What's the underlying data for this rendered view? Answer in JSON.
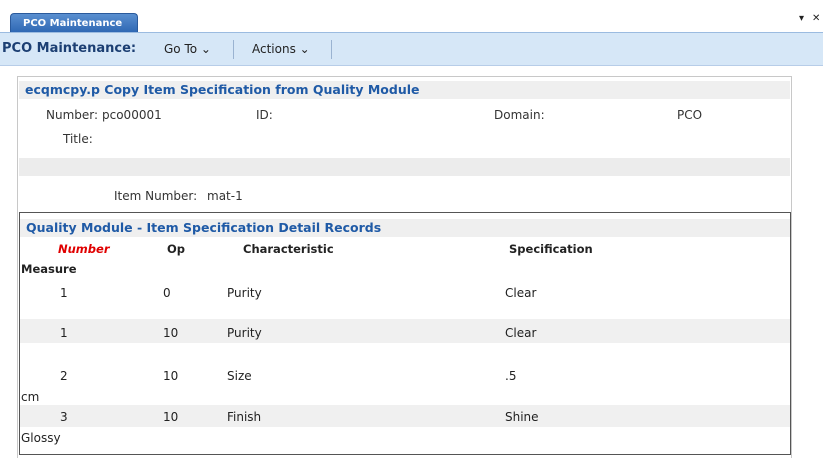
{
  "tabbar": {
    "tab_label": "PCO Maintenance",
    "menu_glyph": "▾",
    "close_glyph": "✕"
  },
  "toolbar": {
    "title": "PCO Maintenance:",
    "goto_label": "Go To ⌄",
    "actions_label": "Actions ⌄"
  },
  "form": {
    "header": "ecqmcpy.p  Copy Item Specification from Quality Module",
    "number_label": "Number:",
    "number_value": "pco00001",
    "id_label": "ID:",
    "domain_label": "Domain:",
    "domain_value": "PCO",
    "title_label": "Title:",
    "item_number_label": "Item Number:",
    "item_number_value": "mat-1"
  },
  "detail": {
    "header": "Quality Module - Item Specification Detail Records",
    "columns": {
      "number": "Number",
      "op": "Op",
      "characteristic": "Characteristic",
      "specification": "Specification",
      "measure": "Measure"
    },
    "rows": [
      {
        "number": "1",
        "op": "0",
        "characteristic": "Purity",
        "specification": "Clear",
        "measure": ""
      },
      {
        "number": "1",
        "op": "10",
        "characteristic": "Purity",
        "specification": "Clear",
        "measure": ""
      },
      {
        "number": "2",
        "op": "10",
        "characteristic": "Size",
        "specification": ".5",
        "measure": "cm"
      },
      {
        "number": "3",
        "op": "10",
        "characteristic": "Finish",
        "specification": "Shine",
        "measure": "Glossy"
      }
    ]
  }
}
